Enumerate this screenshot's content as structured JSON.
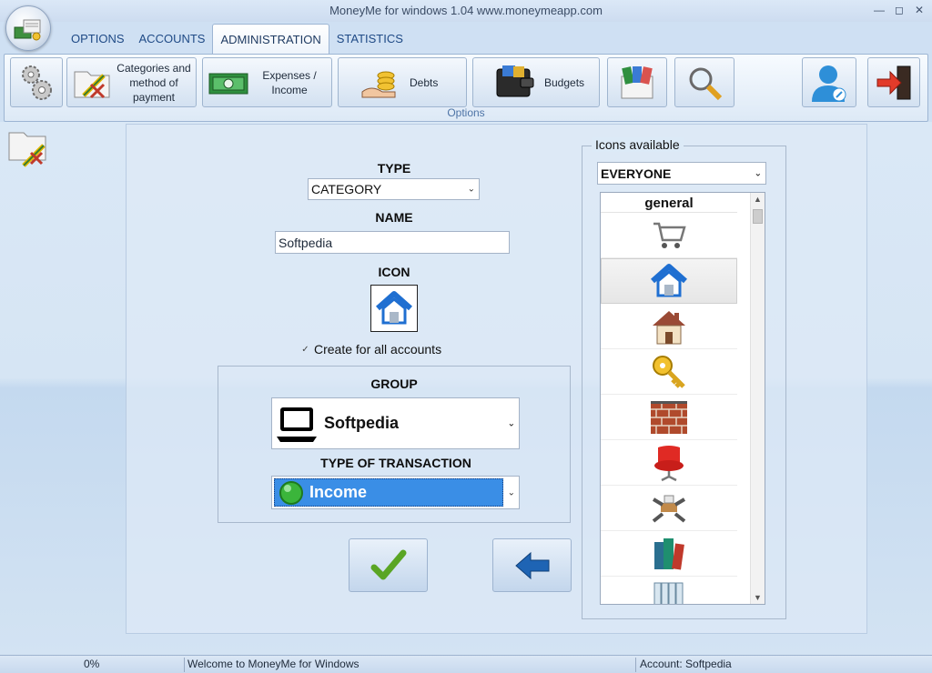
{
  "window": {
    "title": "MoneyMe for windows 1.04 www.moneymeapp.com"
  },
  "menu": {
    "tabs": [
      {
        "label": "OPTIONS"
      },
      {
        "label": "ACCOUNTS"
      },
      {
        "label": "ADMINISTRATION",
        "active": true
      },
      {
        "label": "STATISTICS"
      }
    ]
  },
  "ribbon": {
    "caption": "Options",
    "buttons": {
      "categories": "Categories and method of payment",
      "expenses": "Expenses / Income",
      "debts": "Debts",
      "budgets": "Budgets"
    }
  },
  "form": {
    "type_label": "TYPE",
    "type_value": "CATEGORY",
    "name_label": "NAME",
    "name_value": "Softpedia",
    "icon_label": "ICON",
    "create_all_label": "Create for all accounts",
    "group_label": "GROUP",
    "group_value": "Softpedia",
    "transaction_label": "TYPE OF TRANSACTION",
    "transaction_value": "Income"
  },
  "icons_panel": {
    "legend": "Icons available",
    "filter_value": "EVERYONE",
    "section_header": "general",
    "items": [
      "shopping-cart-icon",
      "house-blue-icon",
      "house-icon",
      "key-icon",
      "brick-wall-icon",
      "armchair-icon",
      "furniture-icon",
      "books-icon",
      "binders-icon"
    ]
  },
  "status": {
    "progress": "0%",
    "message": "Welcome to MoneyMe for Windows",
    "account": "Account: Softpedia"
  },
  "colors": {
    "accent": "#1f4a86",
    "selection": "#3a8ee6",
    "income_green": "#3bb53b"
  }
}
